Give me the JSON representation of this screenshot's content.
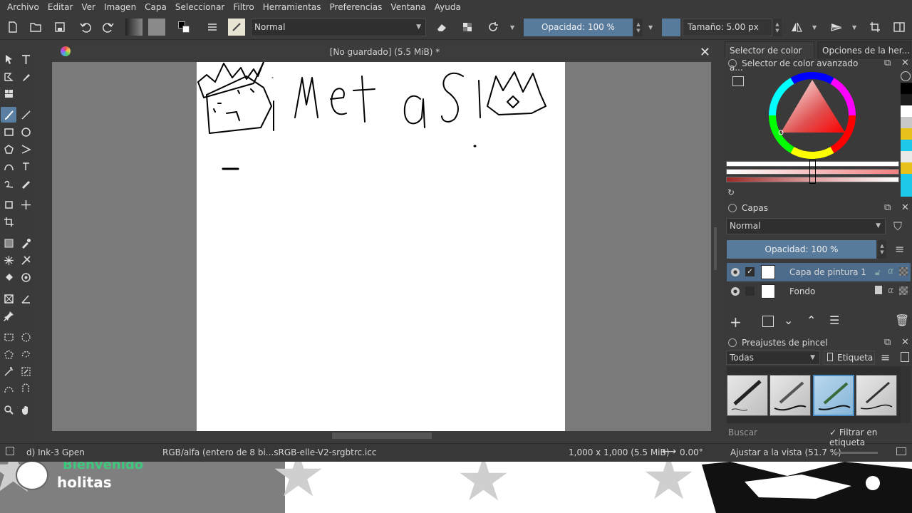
{
  "menu": [
    "Archivo",
    "Editar",
    "Ver",
    "Imagen",
    "Capa",
    "Seleccionar",
    "Filtro",
    "Herramientas",
    "Preferencias",
    "Ventana",
    "Ayuda"
  ],
  "toolbar": {
    "blend_mode": "Normal",
    "opacity": "Opacidad: 100 %",
    "size": "Tamaño: 5.00 px"
  },
  "document": {
    "title": "[No guardado]  (5.5 MiB) *",
    "canvas_text": "metasl"
  },
  "status": {
    "brush": "d) Ink-3 Gpen",
    "color_profile": "RGB/alfa (entero de 8 bi...sRGB-elle-V2-srgbtrc.icc",
    "dimensions": "1,000 x 1,000 (5.5 MiB)",
    "rotation": "0.00°",
    "zoom": "Ajustar a la vista (51.7 %)"
  },
  "dock": {
    "tab_color": "Selector de color a...",
    "tab_tools": "Opciones de la her...",
    "color_panel_title": "Selector de color avanzado",
    "layers_title": "Capas",
    "layers_blend": "Normal",
    "layers_opacity": "Opacidad:  100 %",
    "layers": [
      {
        "name": "Capa de pintura 1",
        "selected": true
      },
      {
        "name": "Fondo",
        "selected": false
      }
    ],
    "brushes_title": "Preajustes de pincel",
    "brush_filter": "Todas",
    "brush_tag": "Etiqueta",
    "search_placeholder": "Buscar",
    "filter_tag_label": "Filtrar en etiqueta"
  },
  "stream": {
    "username": "holitas",
    "ghost_text": "Bienvenido"
  },
  "colors": {
    "accent": "#587b9c",
    "selection": "#4d6c8c",
    "strip": [
      "#000000",
      "#1e1e1e",
      "#ffffff",
      "#c8c8c8",
      "#e8c11a",
      "#1ec8e8",
      "#e8c11a",
      "#1ec8e8",
      "#e8e8e8",
      "#1ec8e8"
    ]
  }
}
